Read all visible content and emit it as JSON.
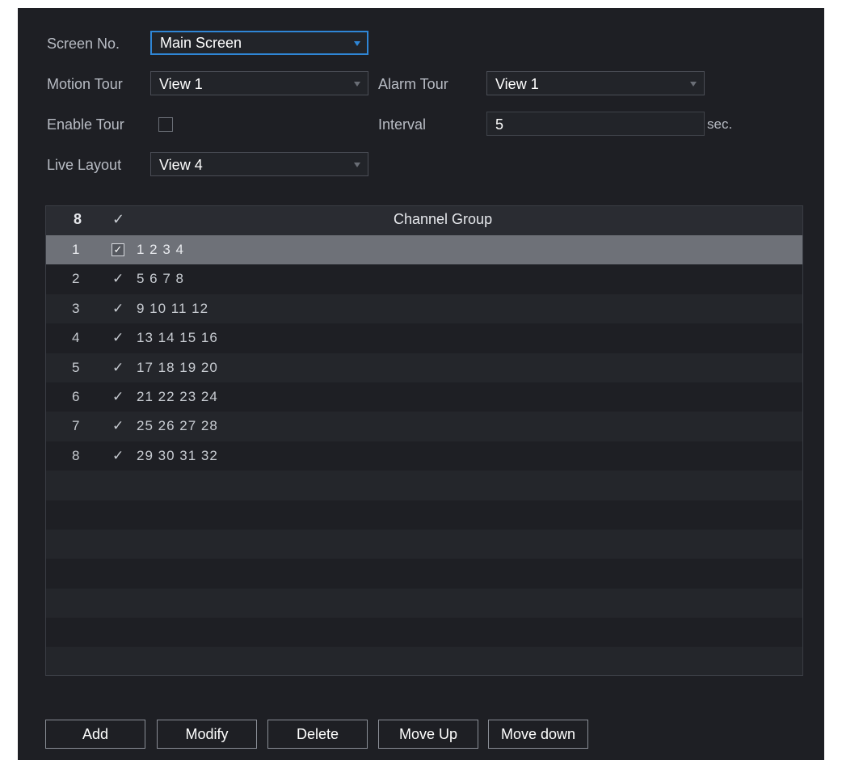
{
  "form": {
    "screen_no": {
      "label": "Screen No.",
      "value": "Main Screen"
    },
    "motion_tour": {
      "label": "Motion Tour",
      "value": "View 1"
    },
    "alarm_tour": {
      "label": "Alarm Tour",
      "value": "View 1"
    },
    "enable_tour": {
      "label": "Enable Tour",
      "checked": false
    },
    "interval": {
      "label": "Interval",
      "value": "5",
      "unit": "sec."
    },
    "live_layout": {
      "label": "Live Layout",
      "value": "View 4"
    }
  },
  "table": {
    "header": {
      "count": "8",
      "check": "✓",
      "group": "Channel Group"
    },
    "rows": [
      {
        "num": "1",
        "check": "✓",
        "group": "1 2 3 4",
        "selected": true
      },
      {
        "num": "2",
        "check": "✓",
        "group": "5 6 7 8"
      },
      {
        "num": "3",
        "check": "✓",
        "group": "9 10 11 12"
      },
      {
        "num": "4",
        "check": "✓",
        "group": "13 14 15 16"
      },
      {
        "num": "5",
        "check": "✓",
        "group": "17 18 19 20"
      },
      {
        "num": "6",
        "check": "✓",
        "group": "21 22 23 24"
      },
      {
        "num": "7",
        "check": "✓",
        "group": "25 26 27 28"
      },
      {
        "num": "8",
        "check": "✓",
        "group": "29 30 31 32"
      }
    ]
  },
  "buttons": {
    "add": "Add",
    "modify": "Modify",
    "delete": "Delete",
    "move_up": "Move Up",
    "move_down": "Move down"
  },
  "colors": {
    "panel_bg": "#1e1f24",
    "accent": "#2f86d6",
    "selected_row": "#6e7178"
  }
}
